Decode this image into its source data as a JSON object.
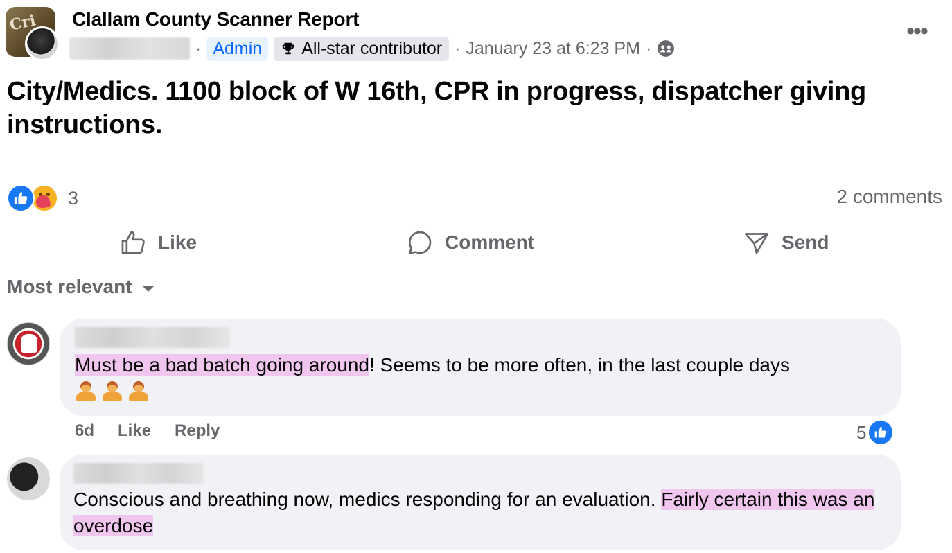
{
  "post": {
    "group_name": "Clallam County Scanner Report",
    "admin_badge": "Admin",
    "allstar_badge": "All-star contributor",
    "timestamp": "January 23 at 6:23 PM",
    "separator": "·",
    "body": "City/Medics. 1100 block of W 16th, CPR in progress, dispatcher giving instructions.",
    "avatar_text": "Cri",
    "icons": {
      "trophy": "trophy-icon",
      "audience": "group-audience-icon",
      "more": "more-options-icon"
    }
  },
  "reactions": {
    "count": "3",
    "comments_count": "2 comments",
    "types": [
      "like",
      "care"
    ]
  },
  "actions": {
    "like_label": "Like",
    "comment_label": "Comment",
    "send_label": "Send"
  },
  "sort": {
    "label": "Most relevant"
  },
  "comments": [
    {
      "highlighted": "Must be a bad batch going around",
      "text": "! Seems to be more often, in the last couple days",
      "emoji": "shrug-emoji x3",
      "age": "6d",
      "like_label": "Like",
      "reply_label": "Reply",
      "reaction_count": "5"
    },
    {
      "text": "Conscious and breathing now, medics responding for an evaluation. ",
      "highlighted": "Fairly certain this was an overdose"
    }
  ],
  "colors": {
    "accent_blue": "#0866ff",
    "like_blue": "#1877f2",
    "secondary_text": "#65676b",
    "bubble_bg": "#f0f2f5",
    "highlight": "#f1c6ee"
  }
}
